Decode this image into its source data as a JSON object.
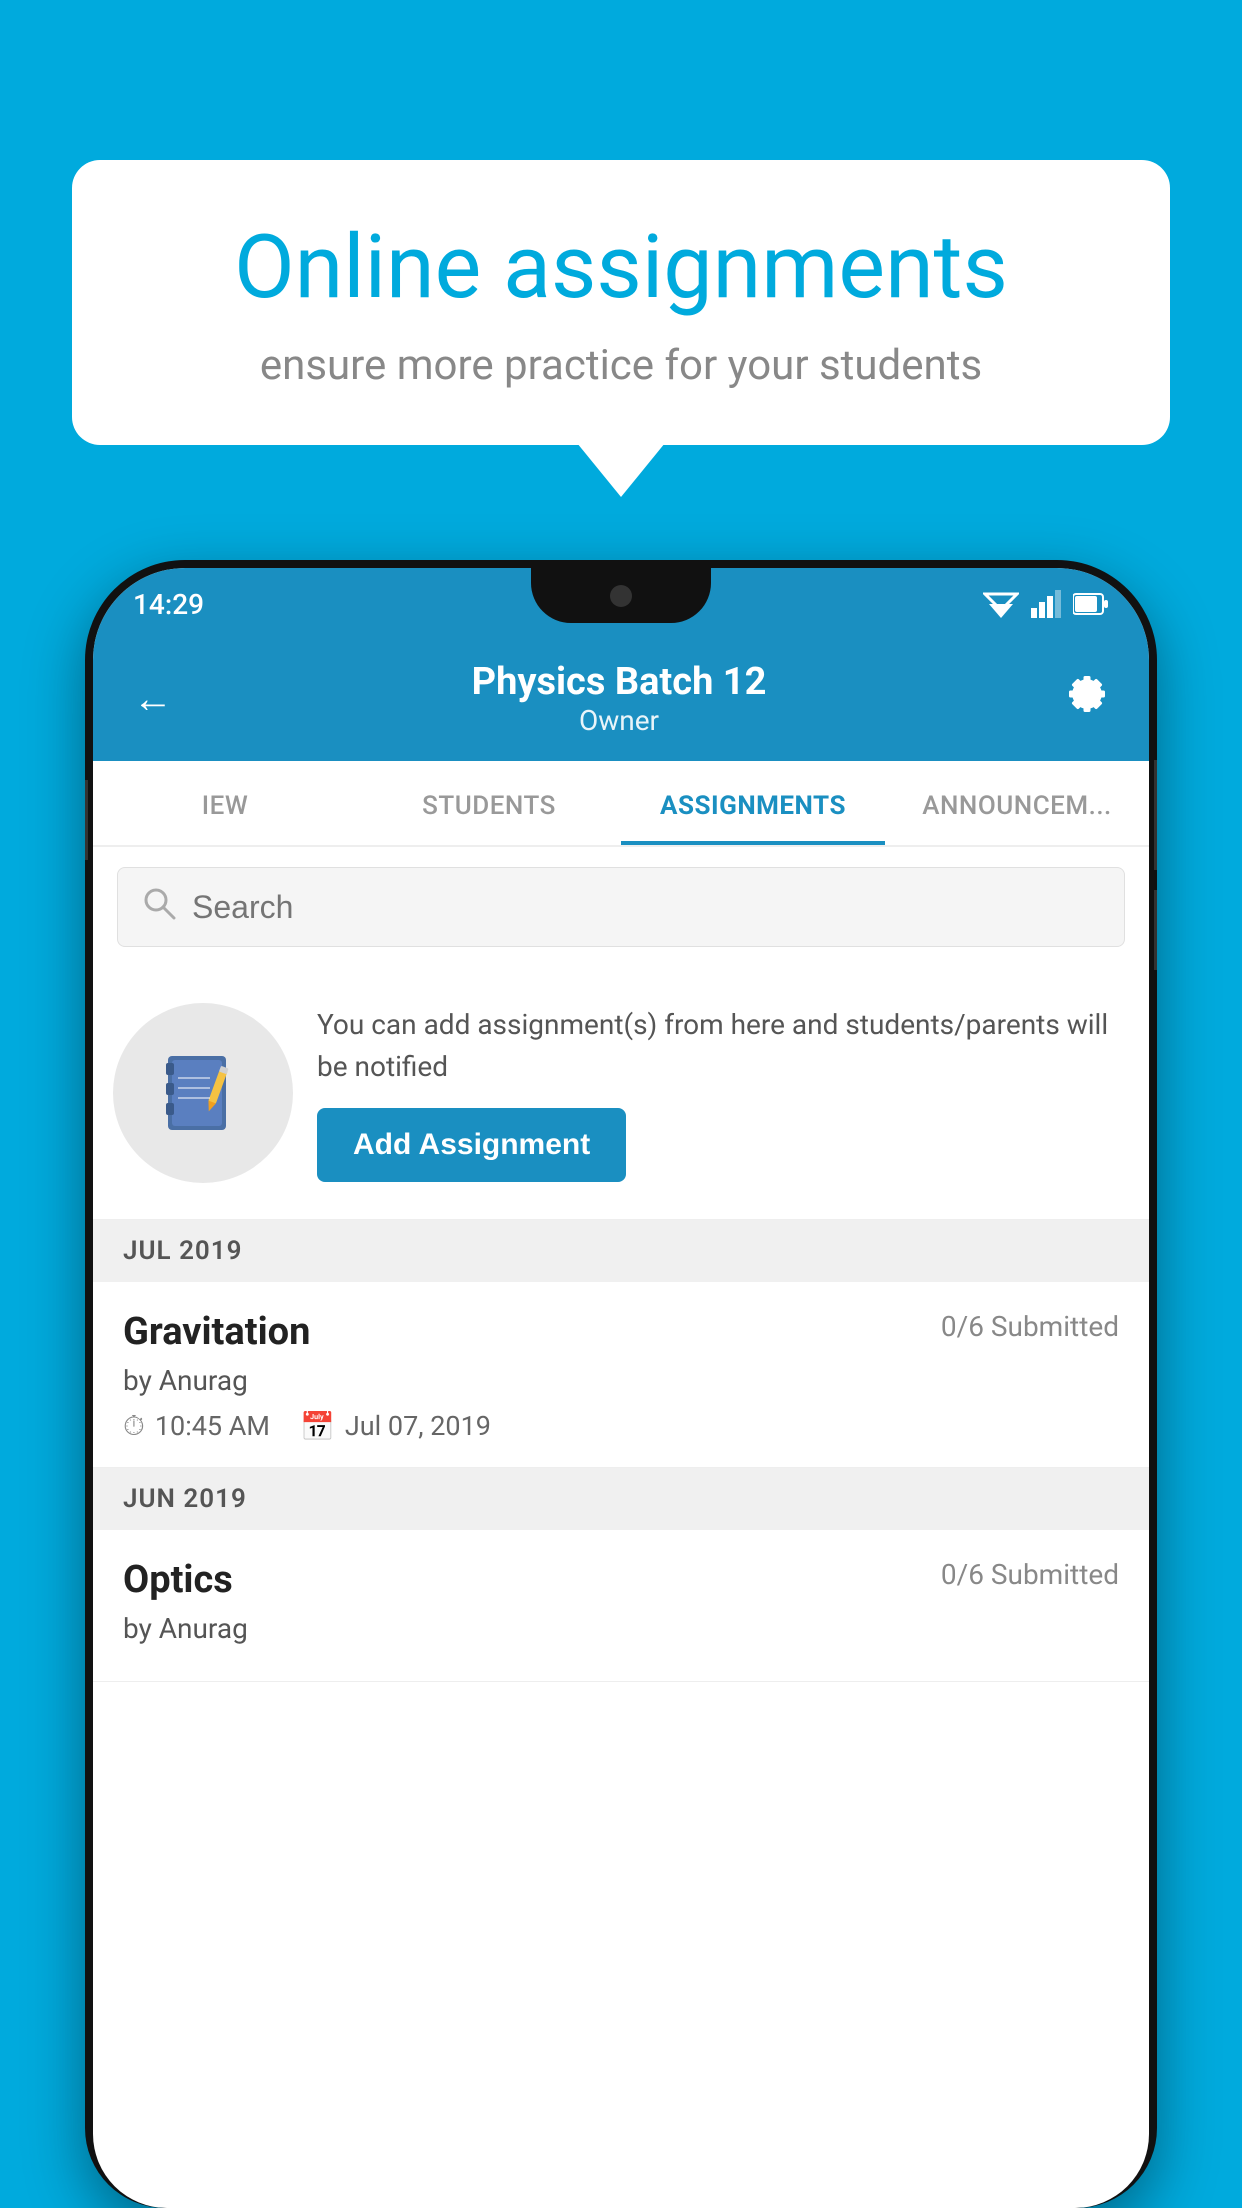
{
  "background_color": "#00AADD",
  "speech_bubble": {
    "title": "Online assignments",
    "subtitle": "ensure more practice for your students"
  },
  "status_bar": {
    "time": "14:29"
  },
  "app_header": {
    "title": "Physics Batch 12",
    "subtitle": "Owner"
  },
  "tabs": [
    {
      "label": "IEW",
      "active": false
    },
    {
      "label": "STUDENTS",
      "active": false
    },
    {
      "label": "ASSIGNMENTS",
      "active": true
    },
    {
      "label": "ANNOUNCEM...",
      "active": false
    }
  ],
  "search": {
    "placeholder": "Search"
  },
  "promo": {
    "description": "You can add assignment(s) from here and students/parents will be notified",
    "button_label": "Add Assignment"
  },
  "sections": [
    {
      "label": "JUL 2019",
      "assignments": [
        {
          "name": "Gravitation",
          "submitted": "0/6 Submitted",
          "author": "by Anurag",
          "time": "10:45 AM",
          "date": "Jul 07, 2019"
        }
      ]
    },
    {
      "label": "JUN 2019",
      "assignments": [
        {
          "name": "Optics",
          "submitted": "0/6 Submitted",
          "author": "by Anurag",
          "time": "",
          "date": ""
        }
      ]
    }
  ]
}
